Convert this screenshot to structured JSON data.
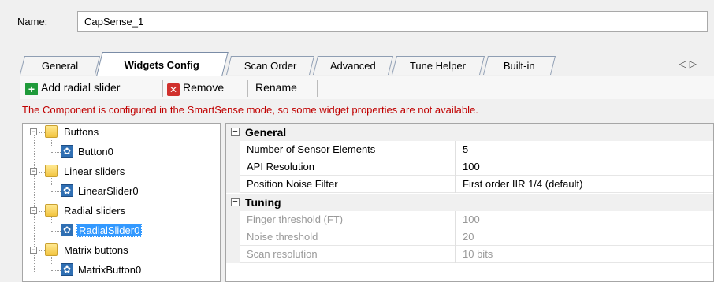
{
  "name_field": {
    "label": "Name:",
    "value": "CapSense_1"
  },
  "tabs": [
    {
      "label": "General"
    },
    {
      "label": "Widgets Config",
      "active": true
    },
    {
      "label": "Scan Order"
    },
    {
      "label": "Advanced"
    },
    {
      "label": "Tune Helper"
    },
    {
      "label": "Built-in"
    }
  ],
  "tab_scroll": {
    "left": "◁",
    "right": "▷"
  },
  "toolbar": {
    "add_icon": "plus-icon",
    "add_label": "Add radial slider",
    "remove_icon": "x-icon",
    "remove_label": "Remove",
    "rename_label": "Rename"
  },
  "warning": "The Component is configured in the SmartSense mode, so some widget properties are not available.",
  "tree": [
    {
      "label": "Buttons",
      "type": "folder"
    },
    {
      "label": "Button0",
      "type": "widget"
    },
    {
      "label": "Linear sliders",
      "type": "folder"
    },
    {
      "label": "LinearSlider0",
      "type": "widget"
    },
    {
      "label": "Radial sliders",
      "type": "folder"
    },
    {
      "label": "RadialSlider0",
      "type": "widget",
      "selected": true
    },
    {
      "label": "Matrix buttons",
      "type": "folder"
    },
    {
      "label": "MatrixButton0",
      "type": "widget"
    }
  ],
  "properties": {
    "general": {
      "title": "General",
      "rows": [
        {
          "key": "Number of Sensor Elements",
          "value": "5"
        },
        {
          "key": "API Resolution",
          "value": "100"
        },
        {
          "key": "Position Noise Filter",
          "value": "First order IIR 1/4 (default)"
        }
      ]
    },
    "tuning": {
      "title": "Tuning",
      "rows": [
        {
          "key": "Finger threshold (FT)",
          "value": "100"
        },
        {
          "key": "Noise threshold",
          "value": "20"
        },
        {
          "key": "Scan resolution",
          "value": "10 bits"
        }
      ]
    }
  },
  "colors": {
    "warning": "#c00000",
    "selection": "#3399ff",
    "disabled_text": "#999999"
  }
}
